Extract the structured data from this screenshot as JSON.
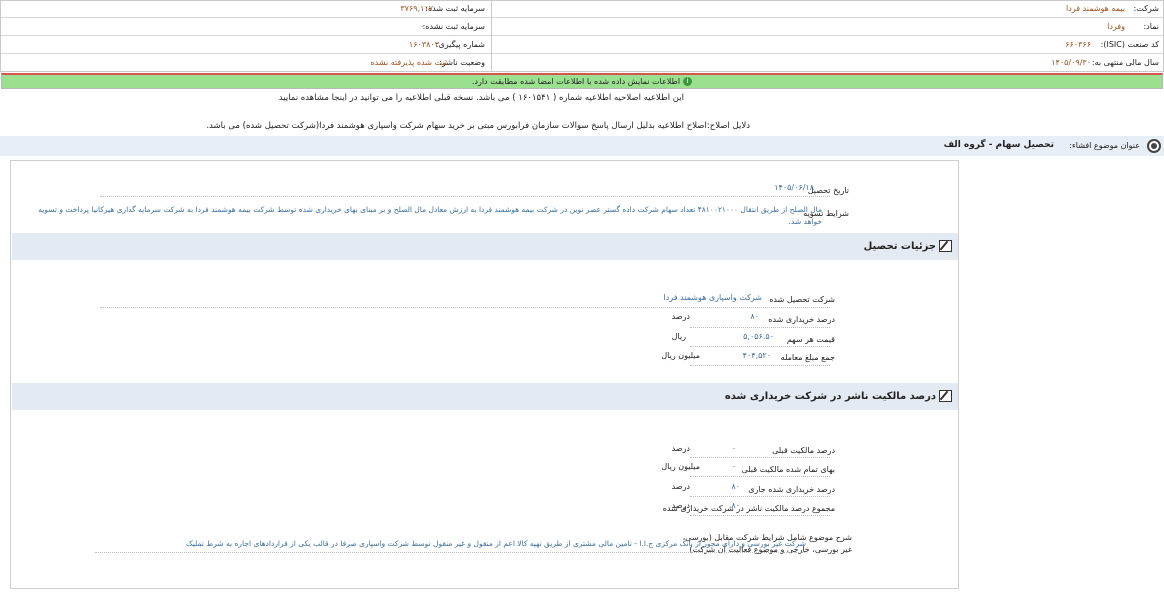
{
  "header": {
    "company_label": "شرکت:",
    "company_value": "بیمه هوشمند فردا",
    "symbol_label": "نماد:",
    "symbol_value": "وفردا",
    "isic_label": "کد صنعت (ISIC):",
    "isic_value": "۶۶۰۳۶۶",
    "fiscal_label": "سال مالی منتهی به:",
    "fiscal_value": "۱۴۰۵/۰۹/۳۰",
    "capital_reg_label": "سرمایه ثبت شده:",
    "capital_reg_value": "۳۷۶۹,۱۱۷",
    "capital_unreg_label": "سرمایه ثبت نشده:",
    "capital_unreg_value": "۰",
    "tracking_label": "شماره پیگیری:",
    "tracking_value": "۱۶۰۳۸۰۳",
    "status_label": "وضعیت ناشر:",
    "status_value": "ثبت شده پذیرفته نشده"
  },
  "notice": {
    "text": "اطلاعات نمایش داده شده با اطلاعات امضا شده مطابقت دارد."
  },
  "correction": {
    "line1": "این اطلاعیه اصلاحیه اطلاعیه شماره ( ۱۶۰۱۵۴۱ ) می باشد. نسخه قبلی اطلاعیه را می توانید در اینجا مشاهده نمایید",
    "reason": "دلایل اصلاح:اصلاح اطلاعیه بدلیل ارسال پاسخ سوالات سازمان فرابورس مبتی بر خرید سهام شرکت واسپاری هوشمند فردا(شرکت تحصیل شده) می باشد."
  },
  "subject": {
    "label": "عنوان موضوع افشاء:",
    "value": "تحصیل سهام - گروه الف"
  },
  "acquisition": {
    "date_label": "تاریخ تحصیل",
    "date_value": "۱۴۰۵/۰۶/۱۸",
    "terms_label": "شرایط تسویه",
    "terms_line1": "مال الصلح از طریق انتقال ۴۸۱۰۰۲۱۰۰۰ تعداد سهام شرکت داده گستر عصر نوین در شرکت بیمه هوشمند فردا به ارزش معادل مال الصلح و بر مبنای بهای خریداری شده توسط شرکت بیمه هوشمند فردا به شرکت سرمایه گذاری هیرکانیا پرداخت و تسویه",
    "terms_line2": "خواهد شد."
  },
  "details": {
    "title": "جزئیات تحصیل",
    "company_label": "شرکت تحصیل شده",
    "company_value": "شرکت واسپاری هوشمند فردا",
    "percent_label": "درصد خریداری شده",
    "percent_value": "۸۰",
    "percent_unit": "درصد",
    "price_label": "قیمت هر سهم",
    "price_value": "۵,۰۵۶.۵۰",
    "price_unit": "ریال",
    "total_label": "جمع مبلغ معامله",
    "total_value": "۴۰۴,۵۲۰",
    "total_unit": "میلیون ریال"
  },
  "ownership": {
    "title": "درصد مالکیت ناشر در شرکت خریداری شده",
    "prev_label": "درصد مالکیت قبلی",
    "prev_value": "۰",
    "prev_unit": "درصد",
    "prev_cost_label": "بهای تمام شده مالکیت قبلی",
    "prev_cost_value": "۰",
    "prev_cost_unit": "میلیون ریال",
    "curr_label": "درصد خریداری شده جاری",
    "curr_value": "۸۰",
    "curr_unit": "درصد",
    "total_label": "مجموع درصد مالکیت ناشر در شرکت خریداری شده",
    "total_value": "۸۰",
    "total_unit": "درصد",
    "desc_label_1": "شرح موضوع شامل شرایط شرکت مقابل (بورسی،",
    "desc_label_2": "غیر بورسی، خارجی و موضوع فعالیت آن شرکت)",
    "desc_value": "شرکت غیر بورسی و دارای مجوز از بانک مرکزی ج.ا.ا - تامین مالی مشتری از طریق تهیه کالا اعم از منقول و غیر منقول توسط شرکت واسپاری صرفا در قالب یکی از قراردادهای اجاره به شرط تملیک"
  },
  "colors": {
    "notice_bg": "#9be08f",
    "value_brown": "#a0521e",
    "value_blue": "#3a6ea5",
    "section_bg": "#e4eaf1"
  }
}
